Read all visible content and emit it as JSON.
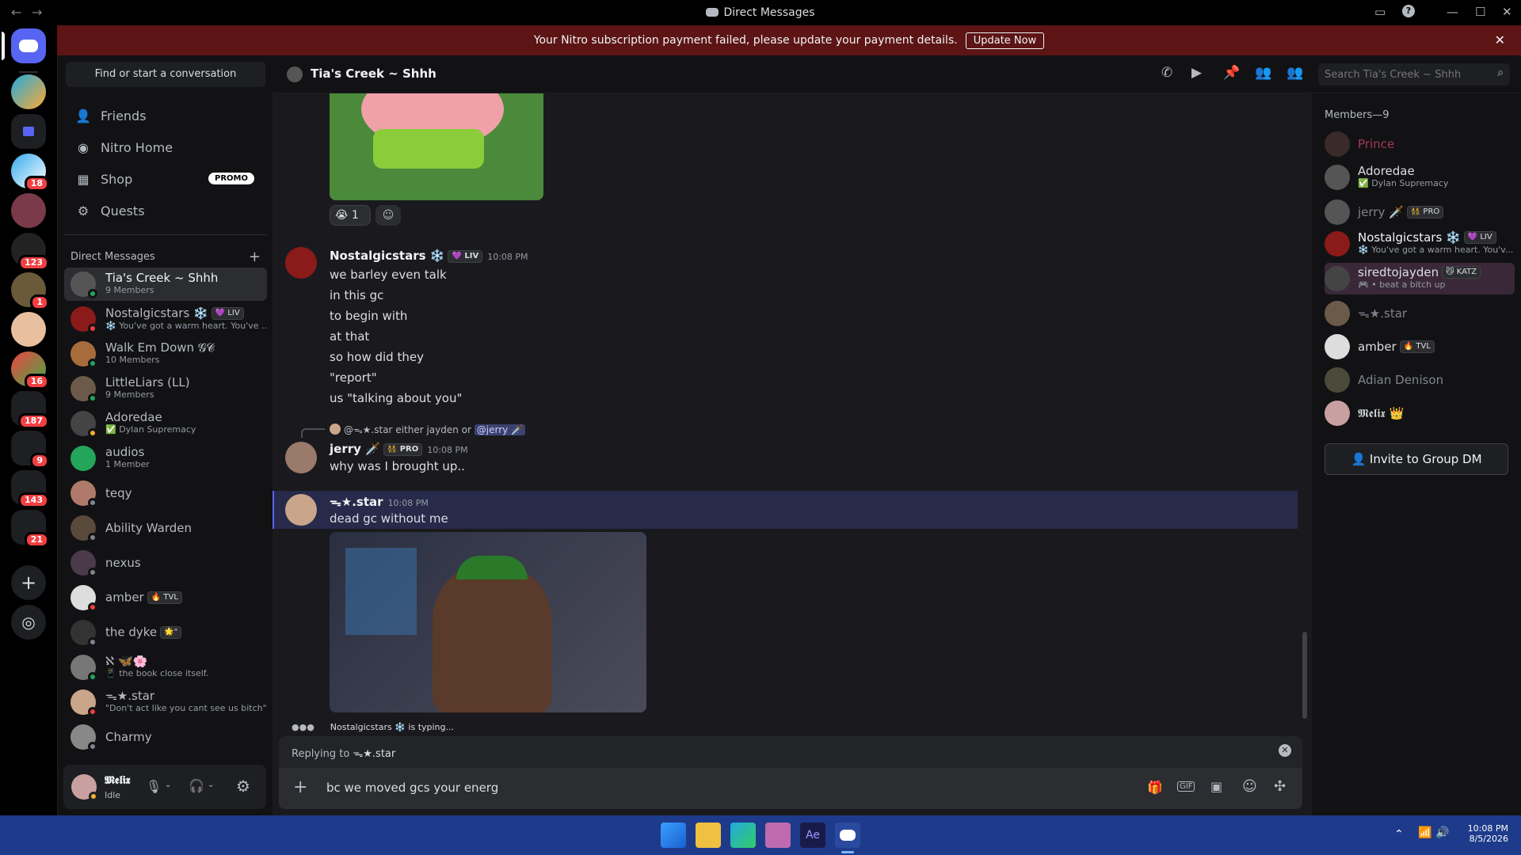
{
  "window": {
    "title": "Direct Messages",
    "back": "←",
    "forward": "→"
  },
  "banner": {
    "text": "Your Nitro subscription payment failed, please update your payment details.",
    "button": "Update Now",
    "close": "✕"
  },
  "rail": {
    "badges": [
      "18",
      "123",
      "1",
      "16",
      "187",
      "9",
      "143",
      "21"
    ]
  },
  "dm_panel": {
    "find": "Find or start a conversation",
    "nav": [
      {
        "label": "Friends",
        "icon": "friends-icon"
      },
      {
        "label": "Nitro Home",
        "icon": "nitro-icon"
      },
      {
        "label": "Shop",
        "icon": "shop-icon",
        "badge": "PROMO"
      },
      {
        "label": "Quests",
        "icon": "quests-icon"
      }
    ],
    "header": "Direct Messages",
    "items": [
      {
        "name": "Tia's Creek ~ Shhh",
        "sub": "9 Members",
        "color": "#555",
        "status": "#23a55a"
      },
      {
        "name": "Nostalgicstars ❄️",
        "tag": "💜 LIV",
        "sub": "❄️ You've got a warm heart. You've ...",
        "color": "#8b1a1a",
        "status": "#f23f42"
      },
      {
        "name": "Walk Em Down 𝓖𝓒",
        "sub": "10 Members",
        "color": "#a86b3c",
        "status": "#23a55a"
      },
      {
        "name": "LittleLiars (LL)",
        "sub": "9 Members",
        "color": "#6b5a4a",
        "status": "#23a55a"
      },
      {
        "name": "Adoredae",
        "sub": "✅ Dylan Supremacy",
        "color": "#444",
        "status": "#f0b232"
      },
      {
        "name": "audios",
        "sub": "1 Member",
        "color": "#23a55a",
        "status": ""
      },
      {
        "name": "teqy",
        "sub": "",
        "color": "#b07a6a",
        "status": "#80848e"
      },
      {
        "name": "Ability Warden",
        "sub": "",
        "color": "#5a4a3a",
        "status": "#80848e"
      },
      {
        "name": "nexus",
        "sub": "",
        "color": "#4a3a4a",
        "status": "#80848e"
      },
      {
        "name": "amber",
        "tag": "🔥 TVL",
        "sub": "",
        "color": "#ddd",
        "status": "#f23f42"
      },
      {
        "name": "the dyke",
        "tag": "🌟\"",
        "sub": "",
        "color": "#333",
        "status": "#80848e"
      },
      {
        "name": "ℵ 🦋🌸",
        "sub": "📱 the book close itself.",
        "color": "#777",
        "status": "#23a55a"
      },
      {
        "name": "ᯓ★.star",
        "sub": "\"Don't act like you cant see us bitch\"",
        "color": "#c9a58a",
        "status": "#f23f42"
      },
      {
        "name": "Charmy",
        "sub": "",
        "color": "#888",
        "status": "#80848e"
      }
    ]
  },
  "user": {
    "name": "𝕸𝖊𝖑𝖎𝖝",
    "status": "Idle"
  },
  "chat": {
    "channel": "Tia's Creek ~ Shhh",
    "search_placeholder": "Search Tia's Creek ~ Shhh",
    "reaction_count": "1",
    "messages": [
      {
        "author": "Nostalgicstars ❄️",
        "tag": "💜 LIV",
        "time": "10:08 PM",
        "lines": [
          "we barley even talk",
          "in this gc",
          "to begin with",
          "at that",
          "so how did they",
          "\"report\"",
          "us \"talking about you\""
        ]
      },
      {
        "author": "jerry 🗡️",
        "tag": "👯 PRO",
        "time": "10:08 PM",
        "reply_to": "@ᯓ★.star",
        "reply_text": "either jayden or",
        "reply_mention": "@jerry 🗡️",
        "lines": [
          "why was I brought up.."
        ]
      },
      {
        "author": "ᯓ★.star",
        "time": "10:08 PM",
        "lines": [
          "dead gc without me"
        ]
      }
    ],
    "typing": "Nostalgicstars ❄️ is typing...",
    "replying_label": "Replying to",
    "replying_to": "ᯓ★.star",
    "input_value": "bc we moved gcs your energ"
  },
  "members": {
    "header": "Members—9",
    "list": [
      {
        "name": "Prince",
        "sub": "",
        "color": "#3a2a2a",
        "nameColor": "#a33a5a"
      },
      {
        "name": "Adoredae",
        "sub": "✅ Dylan Supremacy",
        "color": "#555",
        "nameColor": "#dbdee1"
      },
      {
        "name": "jerry 🗡️",
        "tag": "👯 PRO",
        "sub": "",
        "color": "#555",
        "nameColor": "#80848e"
      },
      {
        "name": "Nostalgicstars ❄️",
        "tag": "💜 LIV",
        "sub": "❄️ You've got a warm heart. You'v...",
        "color": "#8b1a1a",
        "nameColor": "#f2f3f5"
      },
      {
        "name": "siredtojayden",
        "tag": "😼 KATZ",
        "sub": "🎮 • beat a bitch up",
        "color": "#444",
        "nameColor": "#dbdee1"
      },
      {
        "name": "ᯓ★.star",
        "sub": "",
        "color": "#6a5a4a",
        "nameColor": "#80848e"
      },
      {
        "name": "amber",
        "tag": "🔥 TVL",
        "sub": "",
        "color": "#ddd",
        "nameColor": "#dbdee1"
      },
      {
        "name": "Adian Denison",
        "sub": "",
        "color": "#4a4a3a",
        "nameColor": "#80848e"
      },
      {
        "name": "𝕸𝖊𝖑𝖎𝖝 👑",
        "sub": "",
        "color": "#c9a0a0",
        "nameColor": "#dbdee1"
      }
    ],
    "invite": "Invite to Group DM"
  },
  "taskbar": {
    "time": "10:08 PM",
    "date": "8/5/2026"
  }
}
